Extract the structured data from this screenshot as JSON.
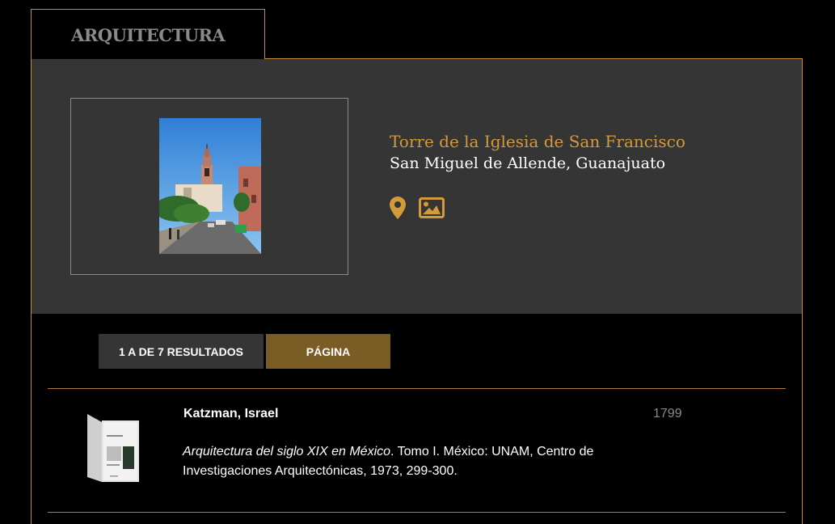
{
  "tab": {
    "label": "ARQUITECTURA"
  },
  "feature": {
    "title": "Torre de la Iglesia de San Francisco",
    "subtitle": "San Miguel de Allende, Guanajuato",
    "icons": [
      "map-pin-icon",
      "image-icon"
    ]
  },
  "pager": {
    "results_label": "1 A DE 7 RESULTADOS",
    "page_label": "PÁGINA"
  },
  "results": [
    {
      "author": "Katzman, Israel",
      "year": "1799",
      "title_italic": "Arquitectura del siglo XIX en México",
      "citation_rest": ". Tomo I. México: UNAM, Centro de Investigaciones Arquitectónicas, 1973, 299-300."
    }
  ],
  "colors": {
    "accent": "#d39a3a",
    "border": "#c8893a",
    "panel": "#353535",
    "page_button": "#7a5c25",
    "background": "#000000"
  }
}
